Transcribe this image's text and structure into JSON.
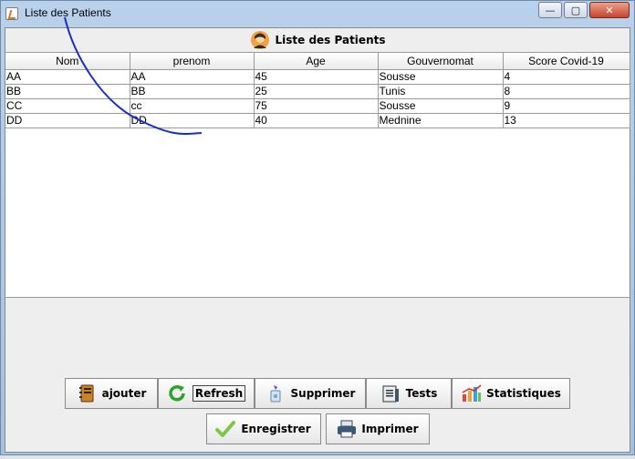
{
  "window": {
    "title": "Liste des Patients",
    "controls": {
      "minimize": "—",
      "maximize": "▢",
      "close": "✕"
    }
  },
  "header": {
    "title": "Liste des Patients",
    "icon": "user-avatar-icon"
  },
  "table": {
    "columns": [
      "Nom",
      "prenom",
      "Age",
      "Gouvernomat",
      "Score Covid-19"
    ],
    "rows": [
      [
        "AA",
        "AA",
        "45",
        "Sousse",
        "4"
      ],
      [
        "BB",
        "BB",
        "25",
        "Tunis",
        "8"
      ],
      [
        "CC",
        "cc",
        "75",
        "Sousse",
        "9"
      ],
      [
        "DD",
        "DD",
        "40",
        "Mednine",
        "13"
      ]
    ]
  },
  "buttons": {
    "ajouter": "ajouter",
    "refresh": "Refresh",
    "supprimer": "Supprimer",
    "tests": "Tests",
    "statistiques": "Statistiques",
    "enregistrer": "Enregistrer",
    "imprimer": "Imprimer"
  },
  "colors": {
    "stroke": "#1b2fbf",
    "titlebar": "#b9d1ea"
  }
}
